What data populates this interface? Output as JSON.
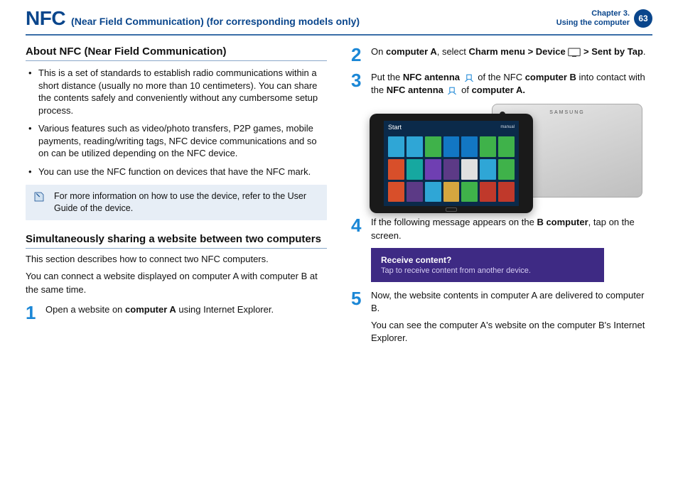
{
  "header": {
    "title_main": "NFC",
    "title_sub": "(Near Field Communication) (for corresponding models only)",
    "chapter_line1": "Chapter 3.",
    "chapter_line2": "Using the computer",
    "page_number": "63"
  },
  "left": {
    "section1_heading": "About NFC (Near Field Communication)",
    "bullets": [
      "This is a set of standards to establish radio communications within a short distance (usually no more than 10 centimeters). You can share the contents safely and conveniently without any cumbersome setup process.",
      "Various features such as video/photo transfers, P2P games, mobile payments, reading/writing tags, NFC device communications and so on can be utilized depending on the NFC device.",
      "You can use the NFC function on devices that have the NFC mark."
    ],
    "note_text": "For more information on how to use the device, refer to the User Guide of the device.",
    "section2_heading": "Simultaneously sharing a website between two computers",
    "section2_p1": "This section describes how to connect two NFC computers.",
    "section2_p2": "You can connect a website displayed on computer A with computer B at the same time.",
    "step1_num": "1",
    "step1_a": "Open a website on ",
    "step1_b": "computer A",
    "step1_c": " using Internet Explorer."
  },
  "right": {
    "step2_num": "2",
    "step2_a": "On ",
    "step2_b": "computer A",
    "step2_c": ", select ",
    "step2_d": "Charm menu > Device",
    "step2_e": " > ",
    "step2_f": "Sent by Tap",
    "step2_g": ".",
    "step3_num": "3",
    "step3_a": "Put the ",
    "step3_b": "NFC antenna",
    "step3_c": " of the NFC ",
    "step3_d": "computer B",
    "step3_e": " into contact with the ",
    "step3_f": "NFC antenna",
    "step3_g": " of ",
    "step3_h": "computer A.",
    "tablet_start": "Start",
    "tablet_user": "manual",
    "tablet_brand": "SAMSUNG",
    "step4_num": "4",
    "step4_a": "If the following message appears on the ",
    "step4_b": "B computer",
    "step4_c": ", tap on the screen.",
    "recv_title": "Receive content?",
    "recv_sub": "Tap to receive content from another device.",
    "step5_num": "5",
    "step5_a": "Now, the website contents in computer A are delivered to computer B.",
    "step5_b": "You can see the computer A's website on the computer B's Internet Explorer."
  },
  "tiles": [
    "#2fa6d6",
    "#2fa6d6",
    "#3fb24a",
    "#1277c4",
    "#1277c4",
    "#3fb24a",
    "#3fb24a",
    "#d84f2a",
    "#16a8a0",
    "#6f3fb2",
    "#5c3a86",
    "#e0e0e0",
    "#2fa6d6",
    "#3fb24a",
    "#d84f2a",
    "#5c3a86",
    "#2fa6d6",
    "#d5a63f",
    "#3fb24a",
    "#c0392b",
    "#c0392b"
  ]
}
